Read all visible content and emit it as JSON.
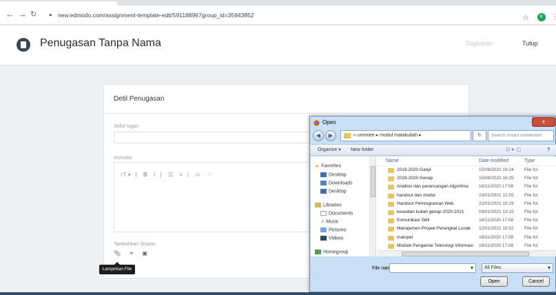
{
  "browser": {
    "url": "new.edmodo.com/assignment-template-edit/591188967group_id=35943852",
    "avatar_letter": "K"
  },
  "header": {
    "title": "Penugasan Tanpa Nama",
    "assign_label": "Tugaskan",
    "close_label": "Tutup"
  },
  "card": {
    "title": "Detil Penugasan",
    "title_field_label": "Judul tugas",
    "instructions_label": "Instruksi",
    "toolbar": {
      "text_size": "тT ▾",
      "bold": "B",
      "italic": "I",
      "bullets": "☰",
      "numbers": "≡",
      "code": "‹/›",
      "link": "↗"
    },
    "attach_label": "Tambahkan Sisipan",
    "tooltip": "Lampirkan File"
  },
  "dialog": {
    "title": "Open",
    "close": "x",
    "breadcrumb": "« ummiee ▸ modul matakuliah ▸",
    "search_placeholder": "Search modul matakuliah",
    "organize": "Organize ▾",
    "new_folder": "New folder",
    "nav": {
      "favorites": "Favorites",
      "desktop": "Desktop",
      "downloads": "Downloads",
      "desktop2": "Desktop",
      "libraries": "Libraries",
      "documents": "Documents",
      "music": "Music",
      "pictures": "Pictures",
      "videos": "Videos",
      "homegroup": "Homegroup"
    },
    "columns": {
      "name": "Name",
      "date": "Date modified",
      "type": "Type"
    },
    "files": [
      {
        "name": "2019-2020 Ganjil",
        "date": "15/08/2020 16:24",
        "type": "File fol"
      },
      {
        "name": "2019-2020 Genap",
        "date": "15/08/2020 16:25",
        "type": "File fol"
      },
      {
        "name": "Analisis dan perancangan Algoritma",
        "date": "16/11/2020 17:08",
        "type": "File fol"
      },
      {
        "name": "handout dan modul",
        "date": "23/01/2021 12:55",
        "type": "File fol"
      },
      {
        "name": "Handout Pemrograman Web",
        "date": "22/01/2021 19:19",
        "type": "File fol"
      },
      {
        "name": "kesedian kuliah genap 2020-2021",
        "date": "09/01/2021 13:15",
        "type": "File fol"
      },
      {
        "name": "Komunikasi Skill",
        "date": "16/11/2020 17:08",
        "type": "File fol"
      },
      {
        "name": "Manajemen Proyek Perangkat Lunak",
        "date": "12/01/2021 15:52",
        "type": "File fol"
      },
      {
        "name": "matopel",
        "date": "16/11/2020 17:08",
        "type": "File fol"
      },
      {
        "name": "Module Pengantar Teknologi Informasi",
        "date": "16/11/2020 17:08",
        "type": "File fol"
      }
    ],
    "file_name_label": "File name:",
    "filter": "All Files",
    "open_button": "Open",
    "cancel_button": "Cancel"
  }
}
